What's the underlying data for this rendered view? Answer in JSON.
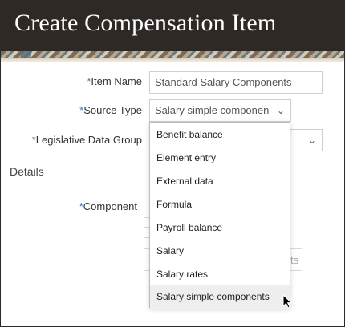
{
  "header": {
    "title": "Create Compensation Item"
  },
  "form": {
    "item_name_label": "Item Name",
    "item_name_value": "Standard Salary Components",
    "source_type_label": "Source Type",
    "source_type_value": "Salary simple componen",
    "ldg_label": "Legislative Data Group",
    "required_marker": "*"
  },
  "details": {
    "section_title": "Details",
    "component_label": "Component",
    "button_hint": "ts"
  },
  "dropdown": {
    "options": [
      "Benefit balance",
      "Element entry",
      "External data",
      "Formula",
      "Payroll balance",
      "Salary",
      "Salary rates",
      "Salary simple components"
    ],
    "selected_option": "Salary simple components"
  },
  "icons": {
    "chevron": "chevron-down-icon",
    "cursor": "mouse-pointer-icon"
  }
}
